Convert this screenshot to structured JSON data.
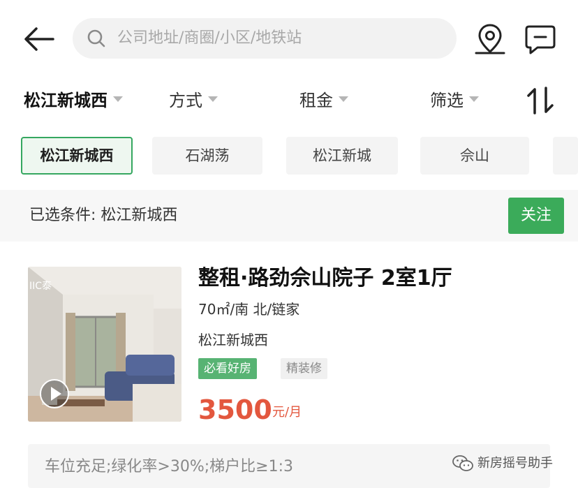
{
  "search": {
    "placeholder": "公司地址/商圈/小区/地铁站"
  },
  "filters": [
    {
      "label": "松江新城西",
      "active": true
    },
    {
      "label": "方式"
    },
    {
      "label": "租金"
    },
    {
      "label": "筛选"
    }
  ],
  "chips": [
    "松江新城西",
    "石湖荡",
    "松江新城",
    "佘山"
  ],
  "selected_conditions": "已选条件: 松江新城西",
  "follow_label": "关注",
  "listing": {
    "title": "整租·路劲佘山院子 2室1厅",
    "meta": "70㎡/南 北/链家",
    "area": "松江新城西",
    "tags": [
      "必看好房",
      "精装修"
    ],
    "price": "3500",
    "price_unit": "元/月",
    "photo_watermark": "IIC泰",
    "description": "车位充足;绿化率>30%;梯户比≥1:3"
  },
  "watermark": "新房摇号助手",
  "colors": {
    "accent": "#3bab5a",
    "price": "#e3573e"
  },
  "icons": [
    "back-arrow-icon",
    "search-icon",
    "map-pin-icon",
    "message-icon",
    "sort-icon",
    "video-play-icon",
    "wechat-icon"
  ]
}
